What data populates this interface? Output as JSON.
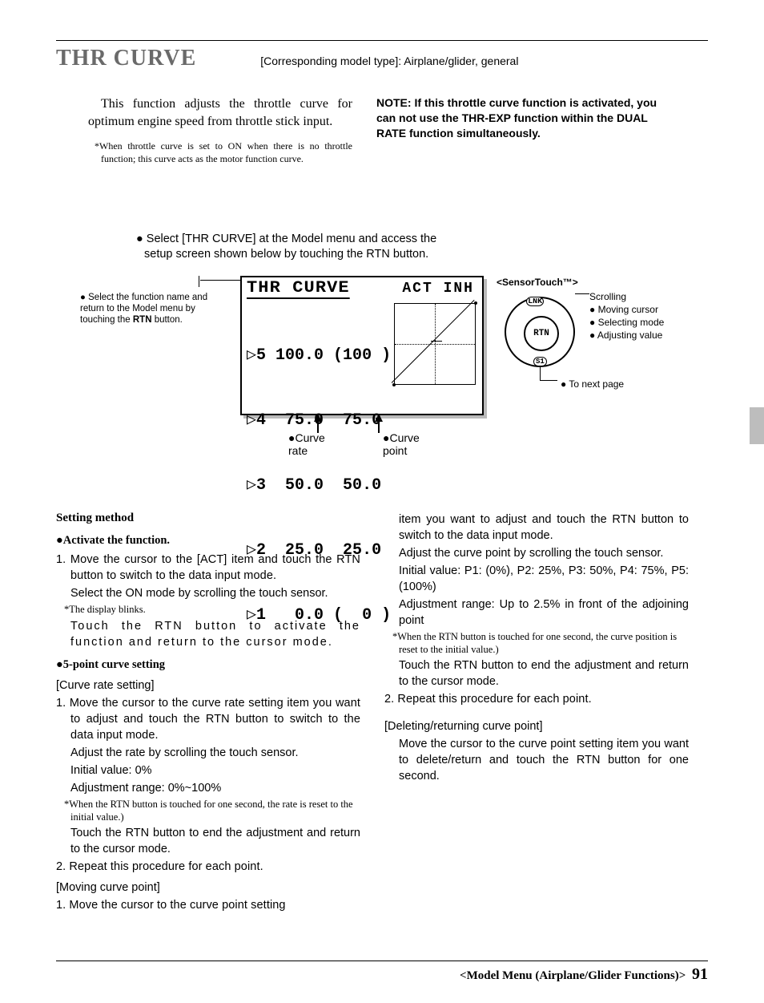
{
  "header": {
    "title": "THR CURVE",
    "subtitle": "[Corresponding model type]: Airplane/glider, general"
  },
  "intro": {
    "para": "This function adjusts the throttle curve for optimum engine speed from throttle stick input.",
    "note": "*When throttle curve is set to ON when there is no throttle function; this curve acts as the motor function curve.",
    "warning": "NOTE: If this throttle curve function is activated, you can not use the THR-EXP function within the DUAL RATE function simultaneously."
  },
  "select_instr": "● Select [THR CURVE] at the Model menu and access the setup screen shown below by touching the RTN button.",
  "left_callout": {
    "text": "● Select the function name and return to the Model menu by touching the ",
    "rtn": "RTN",
    "after": " button."
  },
  "lcd": {
    "title": "THR CURVE",
    "act": "ACT INH",
    "rows": [
      "▷5 100.0 (100 )",
      "▷4  75.0  75.0",
      "▷3  50.0  50.0",
      "▷2  25.0  25.0",
      "▷1   0.0 (  0 )"
    ]
  },
  "arrows": {
    "curve_rate": "●Curve rate",
    "curve_point": "●Curve point"
  },
  "sensor": {
    "title": "<SensorTouch™>",
    "rtn": "RTN",
    "lnk": "LNK",
    "s1": "S1",
    "scrolling": "Scrolling",
    "items": [
      "● Moving cursor",
      "● Selecting mode",
      "● Adjusting value"
    ],
    "tonext": "● To next page"
  },
  "left_col": {
    "setting_method": "Setting method",
    "activate": "●Activate the function.",
    "a1": "1. Move the cursor to the [ACT] item and touch the RTN button to switch to the data input mode.",
    "a2": "Select the ON mode by scrolling the touch sensor.",
    "a_ast": "*The display blinks.",
    "a3": "Touch the RTN button to activate the function and return to the cursor mode.",
    "five_point": "●5-point curve setting",
    "bracket1": "[Curve rate setting]",
    "c1": "1. Move the cursor to the curve rate setting item you want to adjust and touch the RTN button to switch to the data input mode.",
    "c2": "Adjust the rate by scrolling the touch sensor.",
    "c3": "Initial value: 0%",
    "c4": "Adjustment range: 0%~100%",
    "c_ast": "*When the RTN button is touched for one second, the rate is reset to the initial value.)",
    "c5": "Touch the RTN button to end the adjustment and return to the cursor mode.",
    "c6": "2. Repeat this procedure for each point.",
    "bracket2": "[Moving curve point]",
    "m1": "1. Move the cursor to the curve point setting"
  },
  "right_col": {
    "r1": "item you want to adjust and touch the RTN button to switch to the data input mode.",
    "r2": "Adjust the curve point by scrolling the touch sensor.",
    "r3": "Initial value: P1: (0%), P2: 25%, P3: 50%, P4: 75%, P5: (100%)",
    "r4": "Adjustment range: Up to 2.5% in front of the adjoining point",
    "r_ast": "*When the RTN button is touched for one second, the curve position is reset to the initial value.)",
    "r5": "Touch the RTN button to end the adjustment and return to the cursor mode.",
    "r6": "2. Repeat this procedure for each point.",
    "bracket3": "[Deleting/returning curve point]",
    "d1": "Move the cursor to the curve point setting item you want to delete/return and touch the RTN button for one second."
  },
  "footer": {
    "text": "<Model Menu (Airplane/Glider Functions)>",
    "page": "91"
  }
}
